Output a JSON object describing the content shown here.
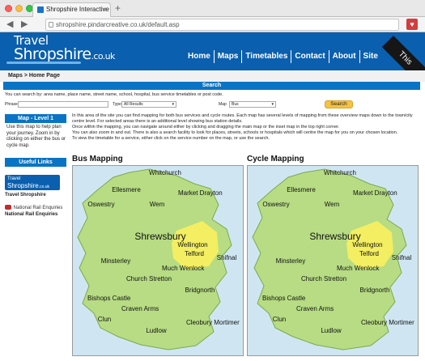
{
  "browser": {
    "tab_title": "Shropshire Interactive Maps",
    "tab_close": "×",
    "new_tab": "+",
    "back": "◀",
    "forward": "▶",
    "url": "shropshire.pindarcreative.co.uk/default.asp"
  },
  "site": {
    "logo_travel": "Travel",
    "logo_shropshire": "Shropshire",
    "logo_couk": ".co.uk",
    "nav": [
      "Home",
      "Maps",
      "Timetables",
      "Contact",
      "About",
      "Site"
    ],
    "ribbon": "This"
  },
  "breadcrumb": "Maps > Home Page",
  "search": {
    "title": "Search",
    "hint": "You can search by: area name, place name, street name, school, hospital, bus service timetables or post code.",
    "phrase_label": "Phrase",
    "phrase_value": "",
    "type_label": "Type",
    "type_value": "All Results",
    "map_label": "Map",
    "map_value": "Bus",
    "button": "Search"
  },
  "sidebar": {
    "map_level": "Map - Level 1",
    "map_help": "Use this map to help plan your journey. Zoom in by clicking on either the bus or cycle map.",
    "useful_links": "Useful Links",
    "ts_logo_travel": "Travel",
    "ts_logo_shrop": "Shropshire",
    "ts_logo_couk": ".co.uk",
    "ts_link": "Travel Shropshire",
    "nre_logo": "National Rail Enquiries",
    "nre_link": "National Rail Enquiries"
  },
  "intro": [
    "In this area of the site you can find mapping for both bus services and cycle routes. Each map has several levels of mapping from these overview maps down to the town/city centre level. For selected areas there is an additional level showing bus station details.",
    "Once within the mapping, you can navigate around either by clicking and dragging the main map or the inset map in the top right corner.",
    "You can also zoom in and out. There is also a search facility to look for places, streets, schools or hospitals which will centre the map for you on your chosen location.",
    "To view the timetable for a service, either click on the service number on the map, or use the search."
  ],
  "maps": [
    {
      "title": "Bus Mapping",
      "icon": "bus-icon",
      "towns": [
        "Whitchurch",
        "Ellesmere",
        "Market Drayton",
        "Oswestry",
        "Wem",
        "Shrewsbury",
        "Wellington",
        "Telford",
        "Shifnal",
        "Minsterley",
        "Much Wenlock",
        "Church Stretton",
        "Bridgnorth",
        "Bishops Castle",
        "Craven Arms",
        "Clun",
        "Ludlow",
        "Cleobury Mortimer"
      ]
    },
    {
      "title": "Cycle Mapping",
      "icon": "bicycle-icon",
      "towns": [
        "Whitchurch",
        "Ellesmere",
        "Market Drayton",
        "Oswestry",
        "Wem",
        "Shrewsbury",
        "Wellington",
        "Telford",
        "Shifnal",
        "Minsterley",
        "Much Wenlock",
        "Church Stretton",
        "Bridgnorth",
        "Bishops Castle",
        "Craven Arms",
        "Clun",
        "Ludlow",
        "Cleobury Mortimer"
      ]
    }
  ],
  "colors": {
    "brand_blue": "#0a5fae",
    "bar_blue": "#0a74c4",
    "county_green": "#b7dc83",
    "telford_yellow": "#f3ee62",
    "search_button": "#f5c242",
    "water": "#cfe6f2"
  }
}
